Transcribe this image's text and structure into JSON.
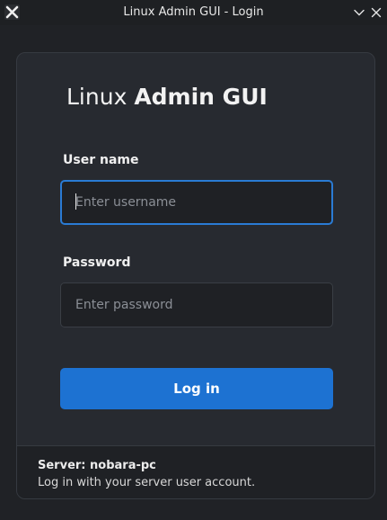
{
  "window": {
    "title": "Linux Admin GUI - Login",
    "app_icon": "x-icon",
    "controls": [
      "chevron-down-icon",
      "close-icon"
    ]
  },
  "brand": {
    "light": "Linux",
    "bold": "Admin GUI"
  },
  "form": {
    "username": {
      "label": "User name",
      "placeholder": "Enter username",
      "value": ""
    },
    "password": {
      "label": "Password",
      "placeholder": "Enter password",
      "value": ""
    },
    "submit_label": "Log in"
  },
  "footer": {
    "server": "Server: nobara-pc",
    "hint": "Log in with your server user account."
  },
  "colors": {
    "accent": "#1d72d2",
    "focus_border": "#2a7bd4",
    "background": "#202226",
    "card": "#272a30"
  }
}
